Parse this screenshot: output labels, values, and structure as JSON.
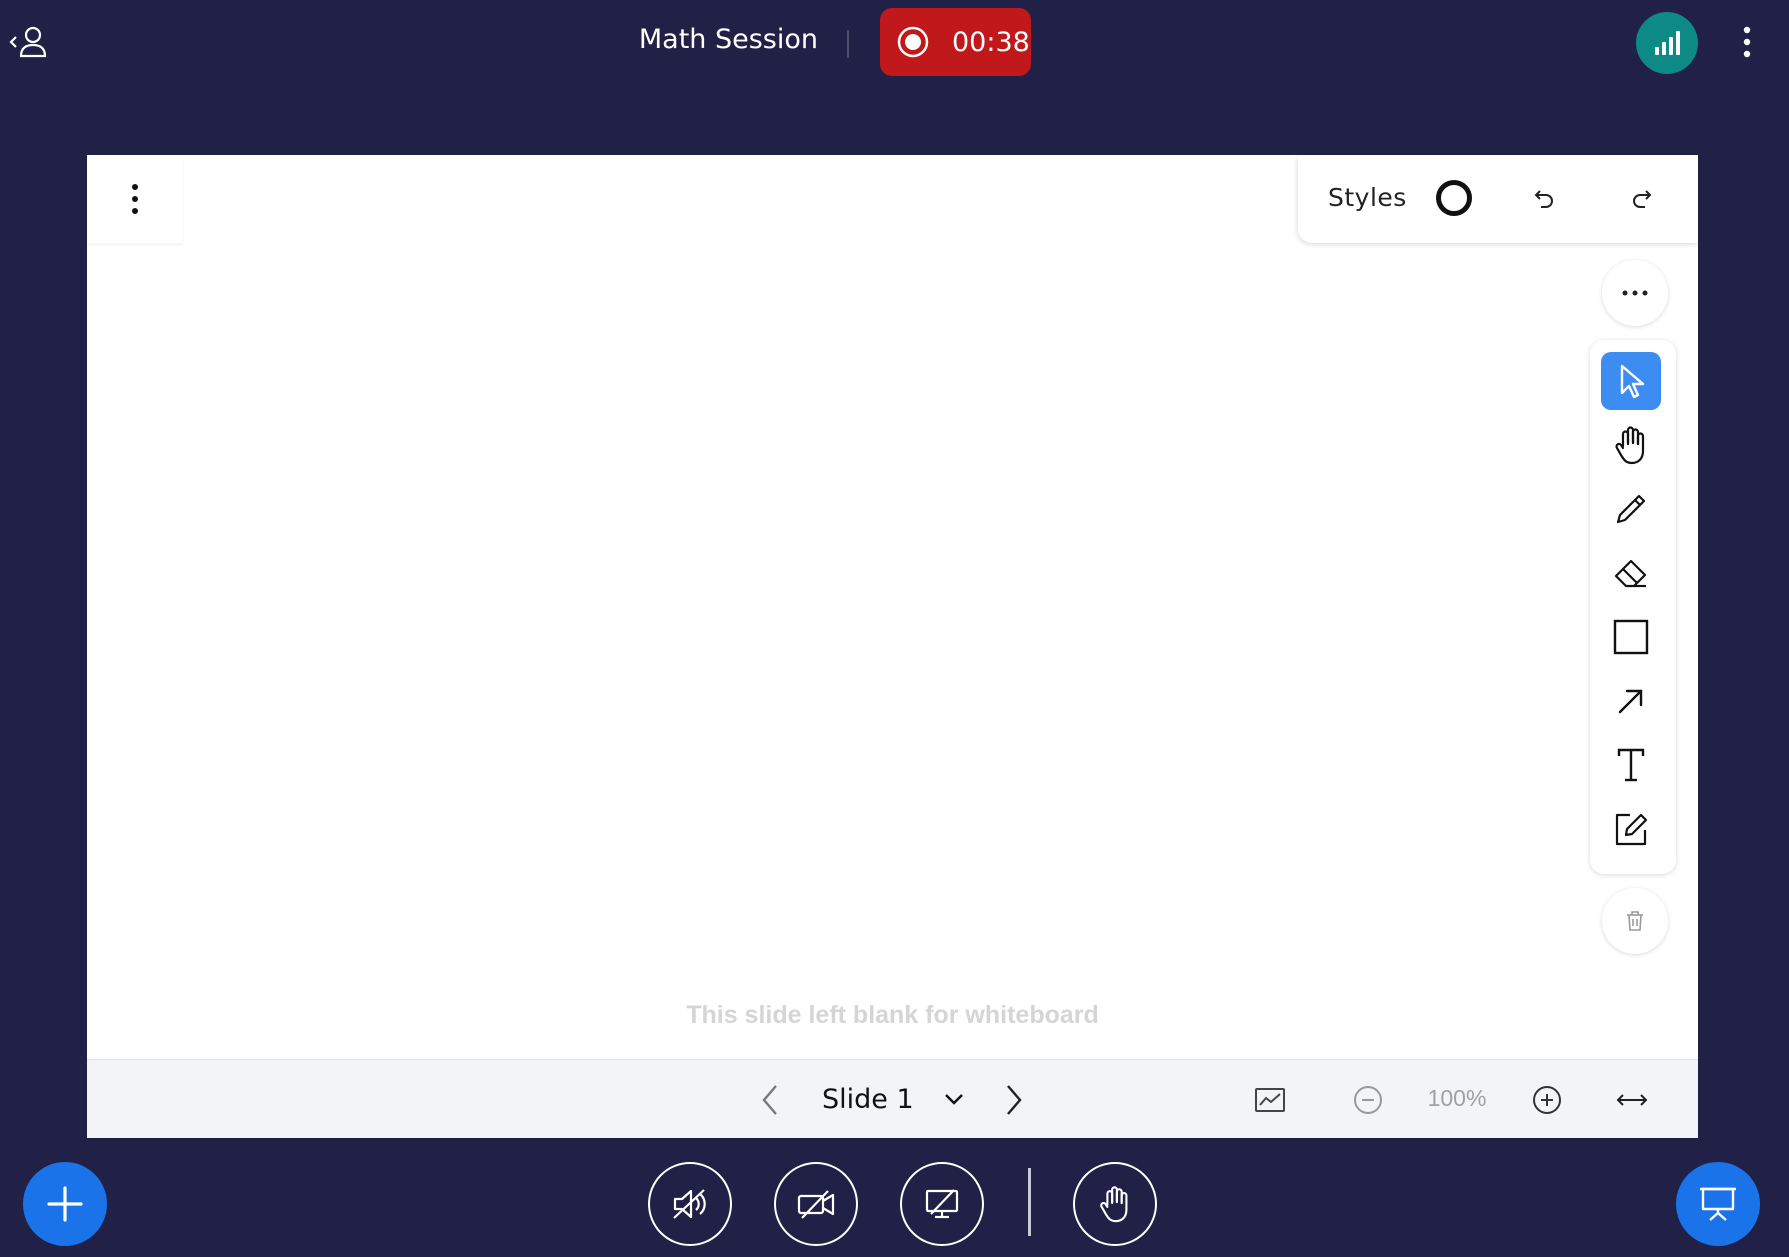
{
  "header": {
    "session_title": "Math Session",
    "recording_time": "00:38",
    "recording_color": "#c0181b",
    "connection_color": "#0d8a86"
  },
  "icons": {
    "user": "user-list-icon",
    "record": "record-icon",
    "connection": "signal-bars-icon",
    "menu": "vertical-dots-icon"
  },
  "whiteboard": {
    "styles_label": "Styles",
    "tools": [
      "select",
      "pan",
      "pencil",
      "eraser",
      "rectangle",
      "arrow",
      "text",
      "note"
    ],
    "active_tool": "select",
    "active_color": "#3c8cf1",
    "blank_message": "This slide left blank for whiteboard"
  },
  "presentation": {
    "slide_label": "Slide 1",
    "zoom_level": "100%"
  },
  "bottom_bar": {
    "controls": [
      "audio-muted",
      "video-off",
      "screenshare-off",
      "raise-hand"
    ],
    "accent": "#1a73e8"
  }
}
